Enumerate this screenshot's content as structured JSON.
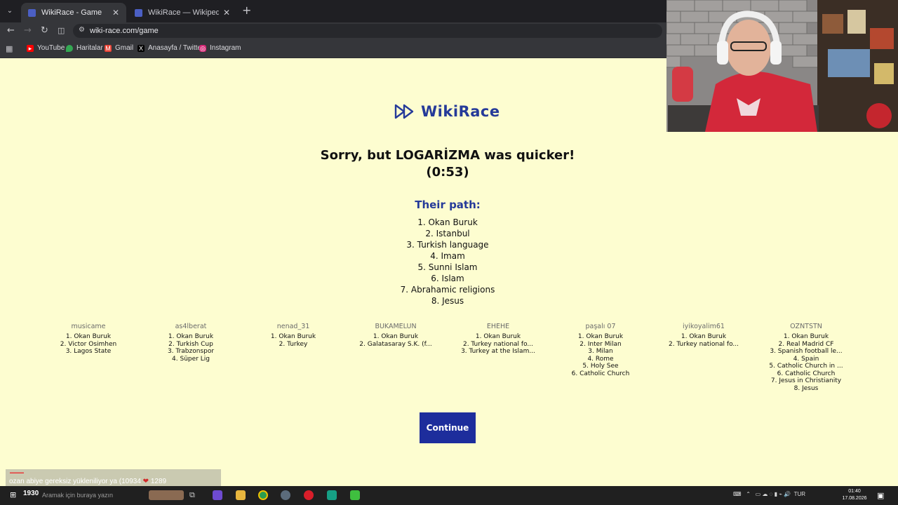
{
  "browser": {
    "tabs": [
      {
        "title": "WikiRace - Game",
        "active": true
      },
      {
        "title": "WikiRace — Wikipedia Yarış Oy",
        "active": false
      }
    ],
    "new_tab": "+",
    "url": "wiki-race.com/game",
    "bookmarks": [
      {
        "label": "YouTube",
        "icon": "youtube-icon",
        "color": "#ff0000"
      },
      {
        "label": "Haritalar",
        "icon": "maps-icon",
        "color": "#34a853"
      },
      {
        "label": "Gmail",
        "icon": "gmail-icon",
        "color": "#ea4335"
      },
      {
        "label": "Anasayfa / Twitter",
        "icon": "x-icon",
        "color": "#000000"
      },
      {
        "label": "Instagram",
        "icon": "instagram-icon",
        "color": "#d62976"
      }
    ]
  },
  "game": {
    "logo": "WikiRace",
    "result": "Sorry, but LOGARİZMA was quicker! (0:53)",
    "their_path_title": "Their path:",
    "their_path": [
      "1. Okan Buruk",
      "2. Istanbul",
      "3. Turkish language",
      "4. Imam",
      "5. Sunni Islam",
      "6. Islam",
      "7. Abrahamic religions",
      "8. Jesus"
    ],
    "players": [
      {
        "name": "musicame",
        "path": [
          "1. Okan Buruk",
          "2. Victor Osimhen",
          "3. Lagos State"
        ]
      },
      {
        "name": "as4lberat",
        "path": [
          "1. Okan Buruk",
          "2. Turkish Cup",
          "3. Trabzonspor",
          "4. Süper Lig"
        ]
      },
      {
        "name": "nenad_31",
        "path": [
          "1. Okan Buruk",
          "2. Turkey"
        ]
      },
      {
        "name": "BUKAMELUN",
        "path": [
          "1. Okan Buruk",
          "2. Galatasaray S.K. (f..."
        ]
      },
      {
        "name": "EHEHE",
        "path": [
          "1. Okan Buruk",
          "2. Turkey national fo...",
          "3. Turkey at the Islam..."
        ]
      },
      {
        "name": "paşalı 07",
        "path": [
          "1. Okan Buruk",
          "2. Inter Milan",
          "3. Milan",
          "4. Rome",
          "5. Holy See",
          "6. Catholic Church"
        ]
      },
      {
        "name": "iyikoyalim61",
        "path": [
          "1. Okan Buruk",
          "2. Turkey national fo..."
        ]
      },
      {
        "name": "OZNTSTN",
        "path": [
          "1. Okan Buruk",
          "2. Real Madrid CF",
          "3. Spanish football le...",
          "4. Spain",
          "5. Catholic Church in ...",
          "6. Catholic Church",
          "7. Jesus in Christianity",
          "8. Jesus"
        ]
      }
    ],
    "continue_label": "Continue",
    "accent_color": "#253a99",
    "background_color": "#fdfdd0"
  },
  "chat": {
    "text": "ozan abiye gereksiz yükleniliyor ya (10934",
    "heart": "❤",
    "count": "1289"
  },
  "taskbar": {
    "count": "1930",
    "search_placeholder": "Aramak için buraya yazın",
    "language": "TUR",
    "time": "01:40",
    "date": "17.08.2026"
  }
}
